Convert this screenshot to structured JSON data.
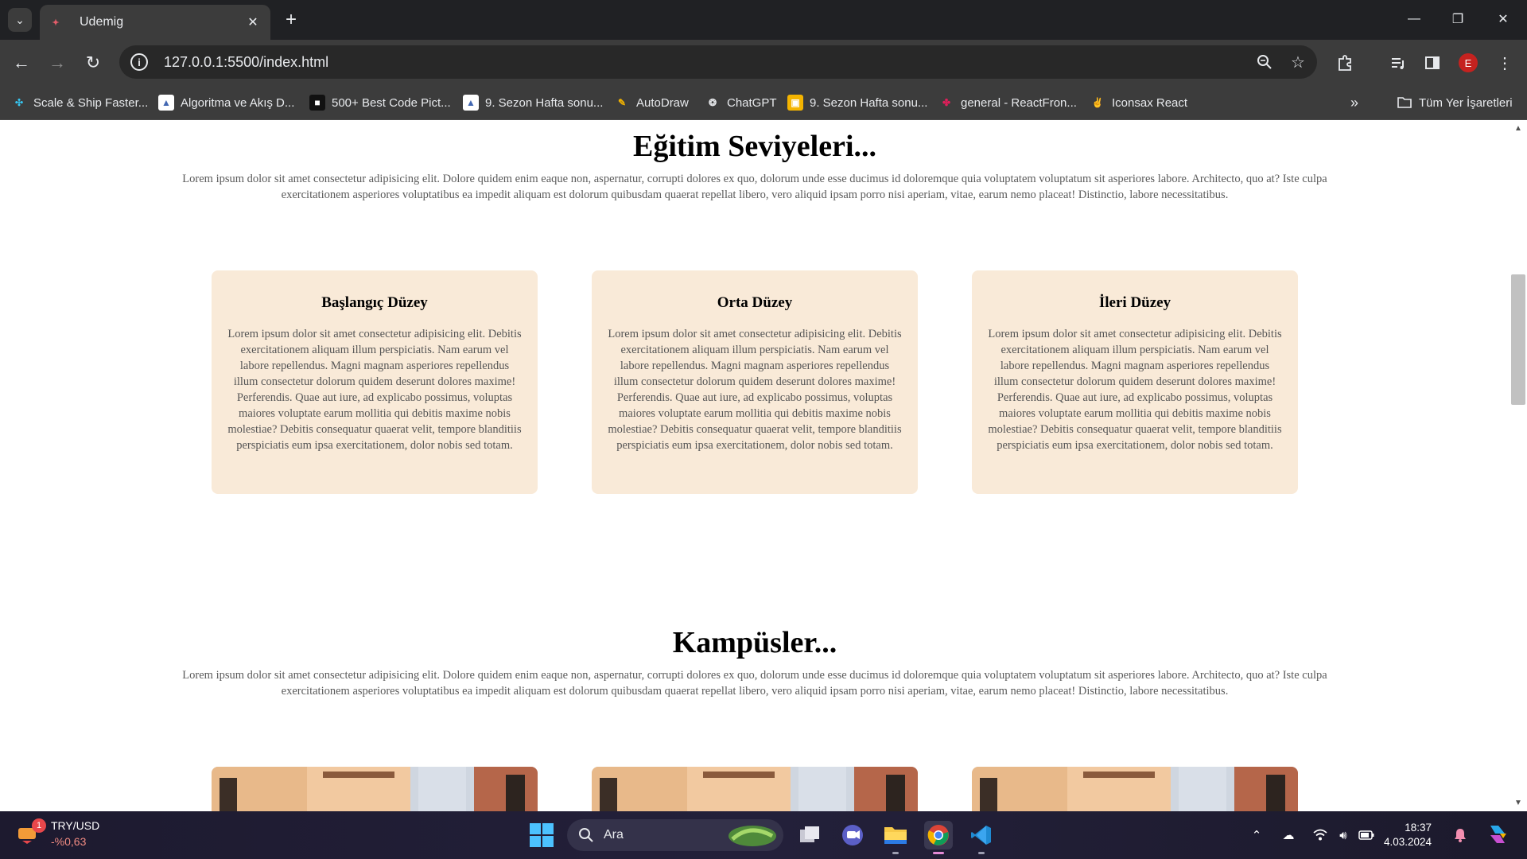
{
  "browser": {
    "tab": {
      "title": "Udemig",
      "favicon": "udemig-favicon"
    },
    "address": "127.0.0.1:5500/index.html",
    "profile_initial": "E",
    "bookmarks": [
      {
        "label": "Scale & Ship Faster...",
        "icon": "slack-like-icon"
      },
      {
        "label": "Algoritma ve Akış D...",
        "icon": "doc-icon"
      },
      {
        "label": "500+ Best Code Pict...",
        "icon": "code-icon"
      },
      {
        "label": "9. Sezon Hafta sonu...",
        "icon": "doc-icon"
      },
      {
        "label": "AutoDraw",
        "icon": "autodraw-icon"
      },
      {
        "label": "ChatGPT",
        "icon": "chatgpt-icon"
      },
      {
        "label": "9. Sezon Hafta sonu...",
        "icon": "slides-icon"
      },
      {
        "label": "general - ReactFron...",
        "icon": "slack-icon"
      },
      {
        "label": "Iconsax React",
        "icon": "hand-icon"
      }
    ],
    "all_bookmarks": "Tüm Yer İşaretleri"
  },
  "page": {
    "levels": {
      "title": "Eğitim Seviyeleri...",
      "description": "Lorem ipsum dolor sit amet consectetur adipisicing elit. Dolore quidem enim eaque non, aspernatur, corrupti dolores ex quo, dolorum unde esse ducimus id doloremque quia voluptatem voluptatum sit asperiores labore. Architecto, quo at? Iste culpa exercitationem asperiores voluptatibus ea impedit aliquam est dolorum quibusdam quaerat repellat libero, vero aliquid ipsam porro nisi aperiam, vitae, earum nemo placeat! Distinctio, labore necessitatibus.",
      "cards": [
        {
          "title": "Başlangıç Düzey",
          "text": "Lorem ipsum dolor sit amet consectetur adipisicing elit. Debitis exercitationem aliquam illum perspiciatis. Nam earum vel labore repellendus. Magni magnam asperiores repellendus illum consectetur dolorum quidem deserunt dolores maxime! Perferendis. Quae aut iure, ad explicabo possimus, voluptas maiores voluptate earum mollitia qui debitis maxime nobis molestiae? Debitis consequatur quaerat velit, tempore blanditiis perspiciatis eum ipsa exercitationem, dolor nobis sed totam."
        },
        {
          "title": "Orta Düzey",
          "text": "Lorem ipsum dolor sit amet consectetur adipisicing elit. Debitis exercitationem aliquam illum perspiciatis. Nam earum vel labore repellendus. Magni magnam asperiores repellendus illum consectetur dolorum quidem deserunt dolores maxime! Perferendis. Quae aut iure, ad explicabo possimus, voluptas maiores voluptate earum mollitia qui debitis maxime nobis molestiae? Debitis consequatur quaerat velit, tempore blanditiis perspiciatis eum ipsa exercitationem, dolor nobis sed totam."
        },
        {
          "title": "İleri Düzey",
          "text": "Lorem ipsum dolor sit amet consectetur adipisicing elit. Debitis exercitationem aliquam illum perspiciatis. Nam earum vel labore repellendus. Magni magnam asperiores repellendus illum consectetur dolorum quidem deserunt dolores maxime! Perferendis. Quae aut iure, ad explicabo possimus, voluptas maiores voluptate earum mollitia qui debitis maxime nobis molestiae? Debitis consequatur quaerat velit, tempore blanditiis perspiciatis eum ipsa exercitationem, dolor nobis sed totam."
        }
      ]
    },
    "campuses": {
      "title": "Kampüsler...",
      "description": "Lorem ipsum dolor sit amet consectetur adipisicing elit. Dolore quidem enim eaque non, aspernatur, corrupti dolores ex quo, dolorum unde esse ducimus id doloremque quia voluptatem voluptatum sit asperiores labore. Architecto, quo at? Iste culpa exercitationem asperiores voluptatibus ea impedit aliquam est dolorum quibusdam quaerat repellat libero, vero aliquid ipsam porro nisi aperiam, vitae, earum nemo placeat! Distinctio, labore necessitatibus."
    },
    "colors": {
      "card_bg": "#f9ead8",
      "text_muted": "#5a5a5a"
    }
  },
  "taskbar": {
    "widget": {
      "pair": "TRY/USD",
      "change": "-%0,63",
      "badge": "1"
    },
    "search_placeholder": "Ara",
    "clock": {
      "time": "18:37",
      "date": "4.03.2024"
    }
  }
}
